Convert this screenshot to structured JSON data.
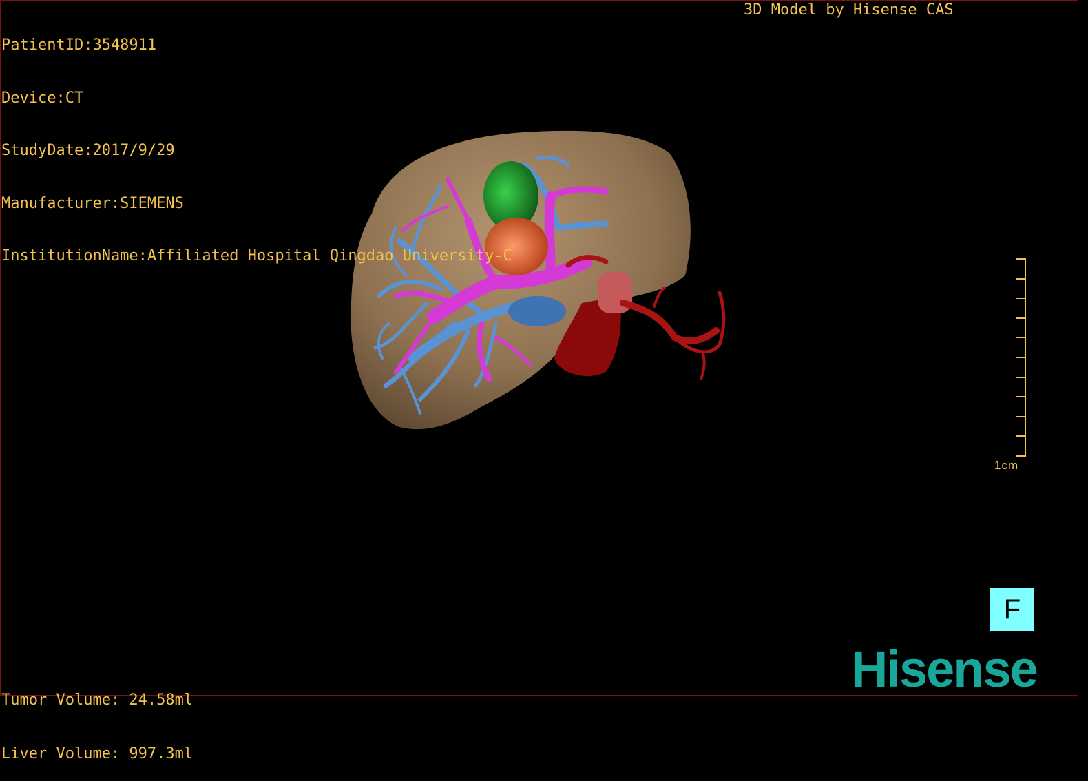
{
  "header": {
    "patient_id": "PatientID:3548911",
    "device": "Device:CT",
    "study_date": "StudyDate:2017/9/29",
    "manufacturer": "Manufacturer:SIEMENS",
    "institution": "InstitutionName:Affiliated Hospital Qingdao University-C"
  },
  "credit": "3D Model by Hisense CAS",
  "volumes": {
    "tumor": "Tumor Volume: 24.58ml",
    "liver": "Liver Volume: 997.3ml"
  },
  "scale_bar": {
    "label": "1cm"
  },
  "orientation_marker": "F",
  "brand_logo": "Hisense",
  "colors": {
    "overlay_text": "#f2c14e",
    "liver": "#8b6d4b",
    "portal_vein": "#d61fd6",
    "hepatic_vein": "#4c86c8",
    "tumor_green": "#1e8c2a",
    "tumor_orange": "#e0642e",
    "artery": "#9c0c0c",
    "orientation_bg": "#7fffff",
    "logo": "#1aa79b"
  }
}
